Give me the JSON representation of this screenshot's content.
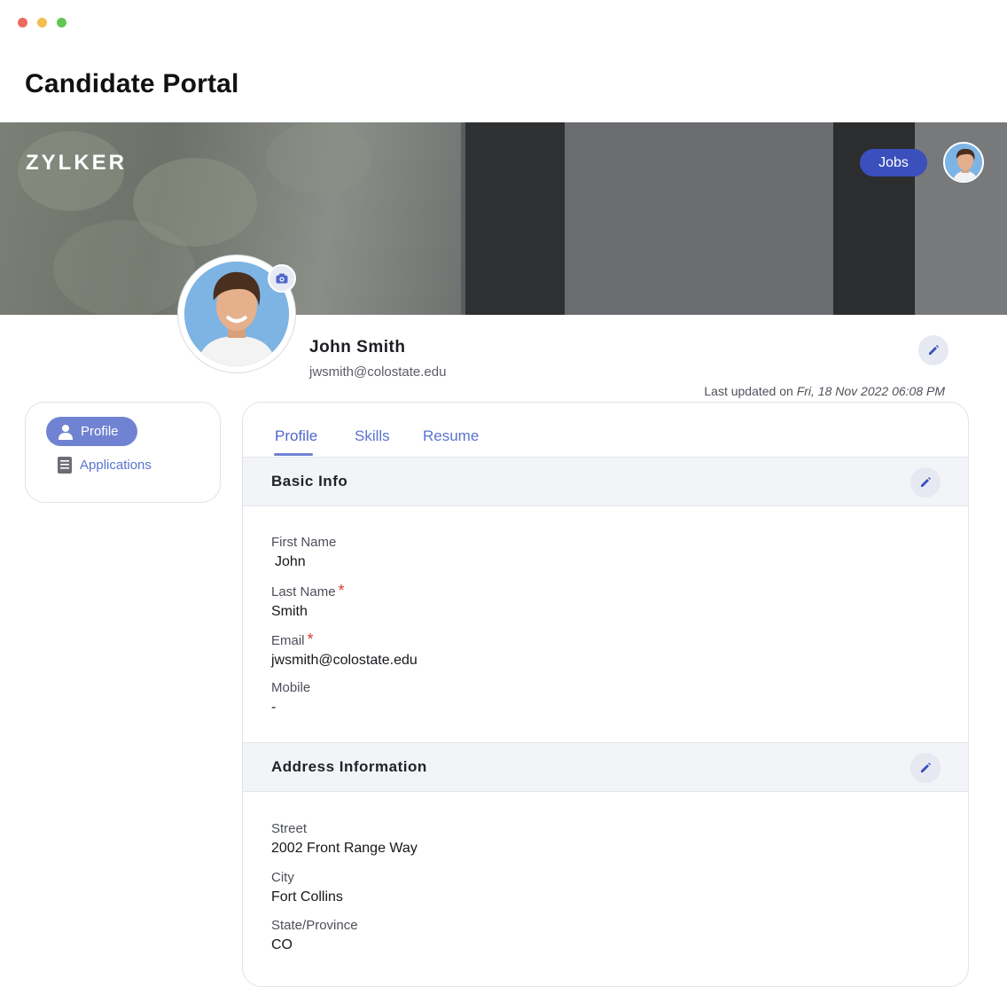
{
  "window": {
    "title": "Candidate Portal"
  },
  "brand": {
    "logo_text": "ZYLKER",
    "accent_color": "#3b4fbd",
    "nav_active_color": "#7083d2"
  },
  "topbar": {
    "jobs_label": "Jobs",
    "avatar_icon": "user-avatar"
  },
  "profile": {
    "name": "John Smith",
    "email": "jwsmith@colostate.edu",
    "last_updated_label": "Last updated on",
    "last_updated_value": "Fri, 18 Nov 2022 06:08 PM"
  },
  "sidebar": {
    "items": [
      {
        "label": "Profile",
        "icon": "person-icon",
        "active": true
      },
      {
        "label": "Applications",
        "icon": "document-icon",
        "active": false
      }
    ]
  },
  "tabs": [
    {
      "label": "Profile",
      "active": true
    },
    {
      "label": "Skills",
      "active": false
    },
    {
      "label": "Resume",
      "active": false
    }
  ],
  "basic_info": {
    "title": "Basic Info",
    "fields": [
      {
        "label": "First Name",
        "value": "John",
        "required": false
      },
      {
        "label": "Last Name",
        "value": "Smith",
        "required": true
      },
      {
        "label": "Email",
        "value": "jwsmith@colostate.edu",
        "required": true
      },
      {
        "label": "Mobile",
        "value": "-",
        "required": false
      }
    ]
  },
  "address_info": {
    "title": "Address Information",
    "fields": [
      {
        "label": "Street",
        "value": "2002 Front Range Way"
      },
      {
        "label": "City",
        "value": "Fort Collins"
      },
      {
        "label": "State/Province",
        "value": "CO"
      }
    ]
  },
  "required_marker": "*"
}
